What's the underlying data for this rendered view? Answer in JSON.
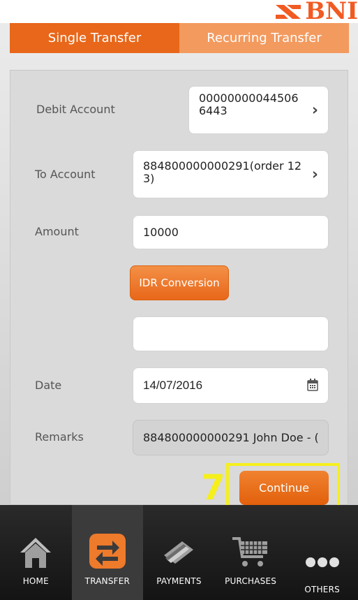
{
  "brand": {
    "name": "BNI"
  },
  "tabs": [
    {
      "label": "Single Transfer",
      "active": true
    },
    {
      "label": "Recurring Transfer",
      "active": false
    }
  ],
  "form": {
    "debit_account": {
      "label": "Debit Account",
      "value": "000000000445066443"
    },
    "to_account": {
      "label": "To Account",
      "value": "884800000000291(order 123)"
    },
    "amount": {
      "label": "Amount",
      "value": "10000"
    },
    "idr_conversion_label": "IDR Conversion",
    "conversion_value": "",
    "date": {
      "label": "Date",
      "value": "14/07/2016"
    },
    "remarks": {
      "label": "Remarks",
      "value": "884800000000291 John Doe - ("
    }
  },
  "continue_label": "Continue",
  "step_number": "7",
  "bottom_nav": [
    {
      "label": "HOME",
      "icon": "home-icon",
      "active": false
    },
    {
      "label": "TRANSFER",
      "icon": "transfer-icon",
      "active": true
    },
    {
      "label": "PAYMENTS",
      "icon": "payments-icon",
      "active": false
    },
    {
      "label": "PURCHASES",
      "icon": "cart-icon",
      "active": false
    },
    {
      "label": "OTHERS",
      "icon": "more-icon",
      "active": false
    }
  ],
  "colors": {
    "accent": "#e8671a",
    "accent_light": "#f39a5f",
    "highlight": "#f5ef1b"
  }
}
